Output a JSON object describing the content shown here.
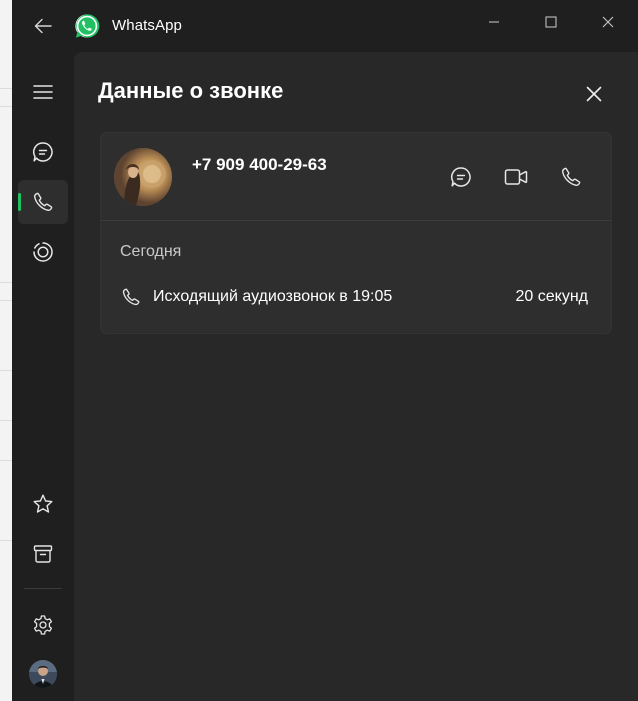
{
  "app": {
    "title": "WhatsApp",
    "accent_color": "#21c063"
  },
  "titlebar": {
    "back_icon": "arrow-left-icon",
    "minimize_icon": "minimize-icon",
    "maximize_icon": "maximize-icon",
    "close_icon": "close-icon"
  },
  "sidebar": {
    "items": [
      {
        "name": "menu",
        "icon": "hamburger-menu-icon",
        "active": false
      },
      {
        "name": "chats",
        "icon": "chat-bubble-icon",
        "active": false
      },
      {
        "name": "calls",
        "icon": "phone-icon",
        "active": true
      },
      {
        "name": "status",
        "icon": "status-ring-icon",
        "active": false
      },
      {
        "name": "starred",
        "icon": "star-icon",
        "active": false
      },
      {
        "name": "archived",
        "icon": "archive-icon",
        "active": false
      },
      {
        "name": "settings",
        "icon": "gear-icon",
        "active": false
      },
      {
        "name": "profile",
        "icon": "avatar",
        "active": false
      }
    ]
  },
  "call_details": {
    "title": "Данные о звонке",
    "contact": {
      "phone": "+7 909 400-29-63"
    },
    "actions": [
      "chat-bubble-icon",
      "video-camera-icon",
      "phone-icon"
    ],
    "section_label": "Сегодня",
    "calls": [
      {
        "description": "Исходящий аудиозвонок в 19:05",
        "duration": "20 секунд"
      }
    ]
  }
}
